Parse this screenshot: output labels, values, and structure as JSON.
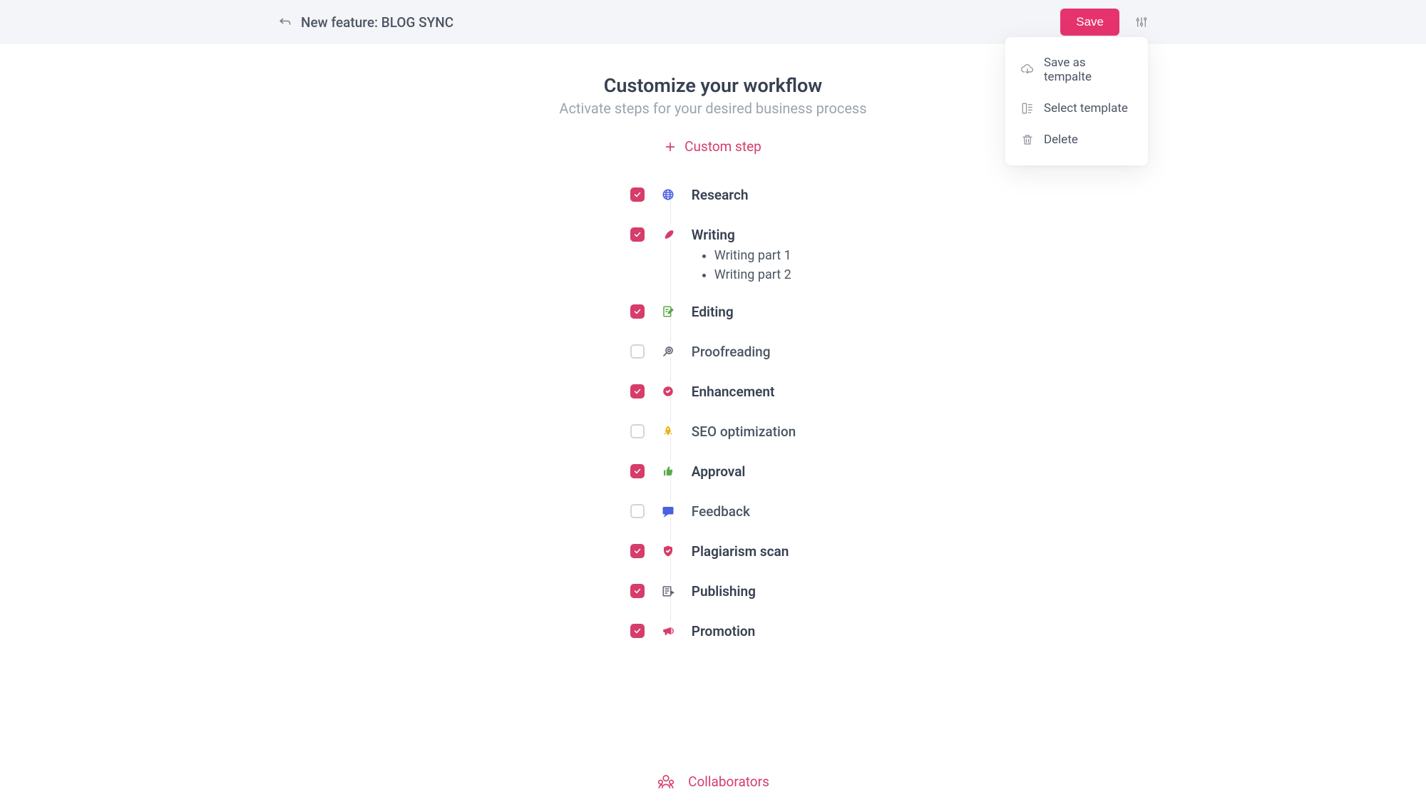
{
  "topbar": {
    "title": "New feature: BLOG SYNC",
    "save_label": "Save"
  },
  "dropdown": {
    "save_template": "Save as tempalte",
    "select_template": "Select template",
    "delete": "Delete"
  },
  "main": {
    "heading": "Customize your workflow",
    "subheading": "Activate steps for your desired business process",
    "custom_step": "Custom step",
    "collaborators": "Collaborators"
  },
  "steps": [
    {
      "label": "Research",
      "checked": true,
      "icon": "globe",
      "color": "#4a5fe0"
    },
    {
      "label": "Writing",
      "checked": true,
      "icon": "feather",
      "color": "#d63d6a",
      "subs": [
        "Writing part 1",
        "Writing part 2"
      ]
    },
    {
      "label": "Editing",
      "checked": true,
      "icon": "edit",
      "color": "#5ca84c"
    },
    {
      "label": "Proofreading",
      "checked": false,
      "icon": "search",
      "color": "#5f6470"
    },
    {
      "label": "Enhancement",
      "checked": true,
      "icon": "badge",
      "color": "#d63d6a"
    },
    {
      "label": "SEO optimization",
      "checked": false,
      "icon": "rocket",
      "color": "#e9b220"
    },
    {
      "label": "Approval",
      "checked": true,
      "icon": "thumb",
      "color": "#5ca84c"
    },
    {
      "label": "Feedback",
      "checked": false,
      "icon": "feedback",
      "color": "#4a5fe0"
    },
    {
      "label": "Plagiarism scan",
      "checked": true,
      "icon": "shield",
      "color": "#d63d6a"
    },
    {
      "label": "Publishing",
      "checked": true,
      "icon": "publish",
      "color": "#5f6470"
    },
    {
      "label": "Promotion",
      "checked": true,
      "icon": "megaphone",
      "color": "#d63d6a"
    }
  ]
}
